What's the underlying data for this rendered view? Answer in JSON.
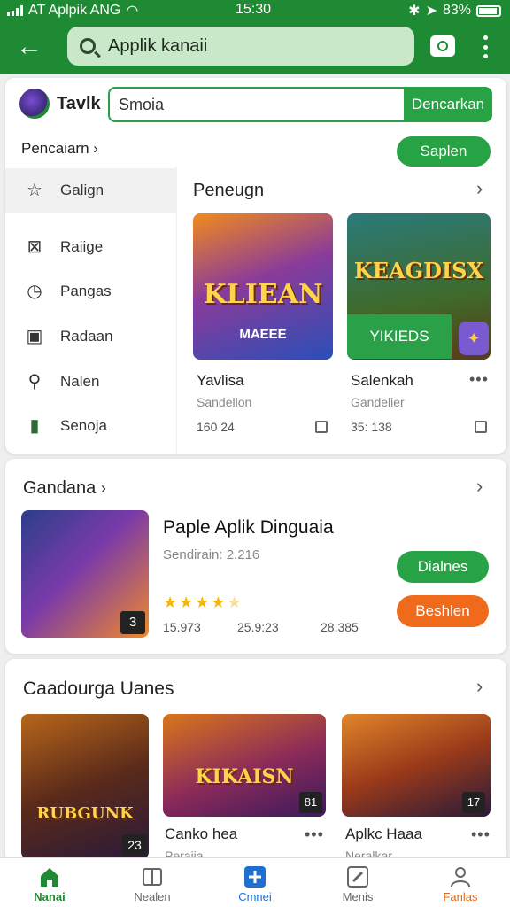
{
  "status": {
    "carrier": "AT Aplpik ANG",
    "time": "15:30",
    "battery": "83%"
  },
  "appbar": {
    "search_text": "Applik kanaii"
  },
  "header": {
    "brand": "Tavlk",
    "search_field_value": "Smoia",
    "search_button": "Dencarkan",
    "breadcrumb": "Pencaiarn",
    "save_button": "Saplen"
  },
  "sidebar": {
    "items": [
      {
        "label": "Galign",
        "icon": "star-icon"
      },
      {
        "label": "Raiige",
        "icon": "box-icon"
      },
      {
        "label": "Pangas",
        "icon": "clock-icon"
      },
      {
        "label": "Radaan",
        "icon": "square-icon"
      },
      {
        "label": "Nalen",
        "icon": "search-icon"
      },
      {
        "label": "Senoja",
        "icon": "folder-icon"
      }
    ]
  },
  "featured": {
    "title": "Peneugn",
    "apps": [
      {
        "art_title": "KLIEAN",
        "art_sub": "MAEEE",
        "name": "Yavlisa",
        "sub": "Sandellon",
        "count": "160 24"
      },
      {
        "art_title": "KEAGDISX",
        "art_banner": "YIKIEDS",
        "name": "Salenkah",
        "sub": "Gandelier",
        "count": "35: 138"
      }
    ]
  },
  "section2": {
    "title": "Gandana",
    "app_title": "Paple Aplik Dinguaia",
    "sub": "Sendirain: 2.216",
    "rating": 4.5,
    "stats": [
      "15.973",
      "25.9:23",
      "28.385"
    ],
    "badge": "3",
    "btn_primary": "Dialnes",
    "btn_secondary": "Beshlen"
  },
  "section3": {
    "title": "Caadourga Uanes",
    "apps": [
      {
        "art_title": "RUBGUNK",
        "badge": "23",
        "name": ""
      },
      {
        "art_title": "KIKAISN",
        "badge": "81",
        "name": "Canko hea",
        "sub": "Peraiia"
      },
      {
        "art_title": "",
        "badge": "17",
        "name": "Aplkc Haaa",
        "sub": "Neralkar"
      }
    ]
  },
  "bottomnav": {
    "items": [
      {
        "label": "Nanai",
        "icon": "home-icon",
        "color": "#1f8a34"
      },
      {
        "label": "Nealen",
        "icon": "book-icon",
        "color": "#666666"
      },
      {
        "label": "Cmnei",
        "icon": "plus-icon",
        "color": "#1f6fd1"
      },
      {
        "label": "Menis",
        "icon": "edit-icon",
        "color": "#666666"
      },
      {
        "label": "Fanlas",
        "icon": "person-icon",
        "color": "#e06a1c"
      }
    ]
  },
  "colors": {
    "primary": "#1f8a34",
    "accent_orange": "#f06a1c",
    "star": "#f3b70b"
  }
}
